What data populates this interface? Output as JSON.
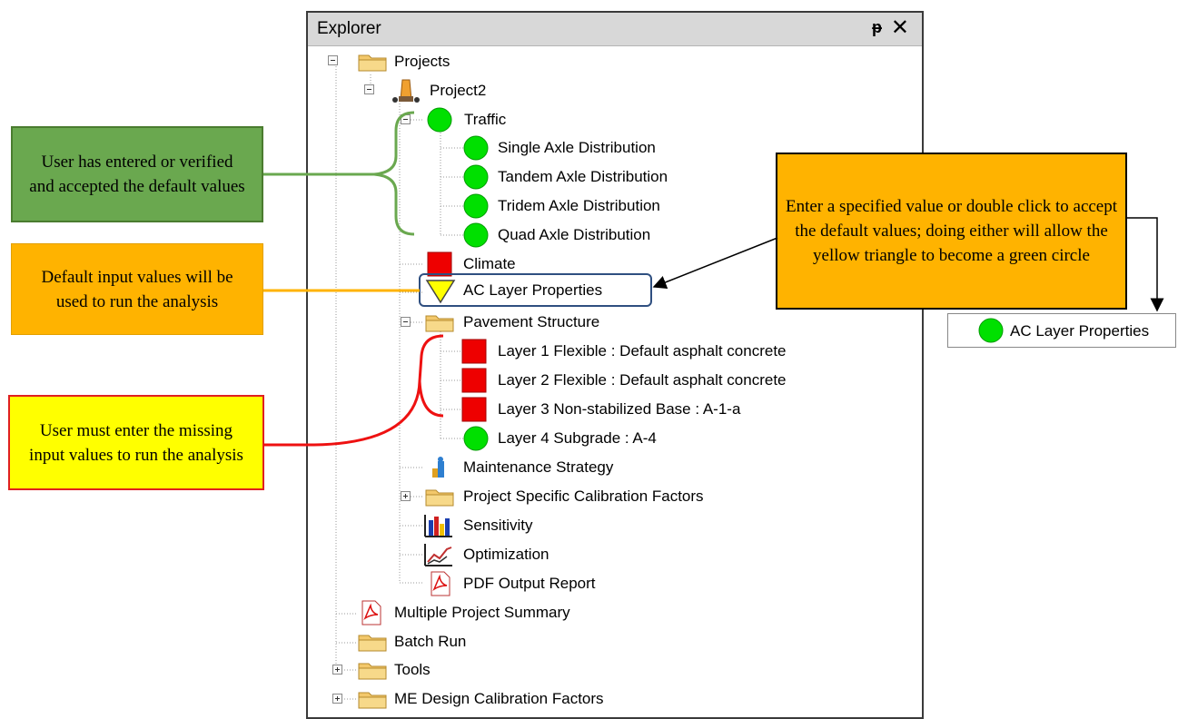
{
  "panel": {
    "title": "Explorer",
    "pin_glyph": "ᵽ",
    "close_glyph": "✕"
  },
  "tree": [
    {
      "label": "Projects",
      "icon": "folder-icon"
    },
    {
      "label": "Project2",
      "icon": "project-icon"
    },
    {
      "label": "Traffic",
      "icon": "green-circle-icon"
    },
    {
      "label": "Single Axle Distribution",
      "icon": "green-circle-icon"
    },
    {
      "label": "Tandem Axle Distribution",
      "icon": "green-circle-icon"
    },
    {
      "label": "Tridem Axle Distribution",
      "icon": "green-circle-icon"
    },
    {
      "label": "Quad Axle Distribution",
      "icon": "green-circle-icon"
    },
    {
      "label": "Climate",
      "icon": "red-square-icon"
    },
    {
      "label": "AC Layer Properties",
      "icon": "yellow-triangle-icon"
    },
    {
      "label": "Pavement Structure",
      "icon": "folder-icon"
    },
    {
      "label": "Layer 1 Flexible : Default asphalt concrete",
      "icon": "red-square-icon"
    },
    {
      "label": "Layer 2 Flexible : Default asphalt concrete",
      "icon": "red-square-icon"
    },
    {
      "label": "Layer 3 Non-stabilized Base : A-1-a",
      "icon": "red-square-icon"
    },
    {
      "label": "Layer 4 Subgrade : A-4",
      "icon": "green-circle-icon"
    },
    {
      "label": "Maintenance Strategy",
      "icon": "maintenance-icon"
    },
    {
      "label": "Project Specific Calibration Factors",
      "icon": "folder-icon"
    },
    {
      "label": "Sensitivity",
      "icon": "bar-chart-icon"
    },
    {
      "label": "Optimization",
      "icon": "line-chart-icon"
    },
    {
      "label": "PDF Output Report",
      "icon": "pdf-icon"
    },
    {
      "label": "Multiple Project Summary",
      "icon": "pdf-icon"
    },
    {
      "label": "Batch Run",
      "icon": "folder-icon"
    },
    {
      "label": "Tools",
      "icon": "folder-icon"
    },
    {
      "label": "ME Design Calibration Factors",
      "icon": "folder-icon"
    }
  ],
  "callouts": {
    "green": "User has entered or verified and accepted the default values",
    "orange": "Default input values will be used to run the analysis",
    "yellow": "User must enter the missing input values to run the analysis",
    "right": "Enter a specified value or double click to accept the default values; doing either will allow the yellow triangle to become a green circle"
  },
  "result_node": {
    "label": "AC Layer Properties",
    "icon": "green-circle-icon"
  },
  "colors": {
    "status_green": "#00e000",
    "status_red": "#ee0000",
    "status_yellow": "#ffff00",
    "callout_green": "#6aa84f",
    "callout_orange": "#ffb300",
    "callout_yellow": "#ffff00",
    "bracket_green": "#6aa84f",
    "bracket_orange": "#ffb300",
    "bracket_red": "#ee1111",
    "highlight_border": "#2f4f80"
  }
}
